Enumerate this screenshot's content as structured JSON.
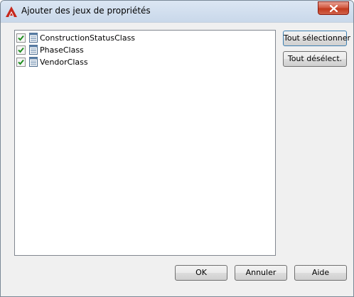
{
  "window": {
    "title": "Ajouter des jeux de propriétés",
    "brand_color": "#c7281d"
  },
  "list": {
    "items": [
      {
        "label": "ConstructionStatusClass",
        "checked": true,
        "icon": "property-set-icon"
      },
      {
        "label": "PhaseClass",
        "checked": true,
        "icon": "property-set-icon"
      },
      {
        "label": "VendorClass",
        "checked": true,
        "icon": "property-set-icon"
      }
    ]
  },
  "buttons": {
    "select_all": "Tout sélectionner",
    "deselect_all": "Tout désélect.",
    "ok": "OK",
    "cancel": "Annuler",
    "help": "Aide"
  }
}
